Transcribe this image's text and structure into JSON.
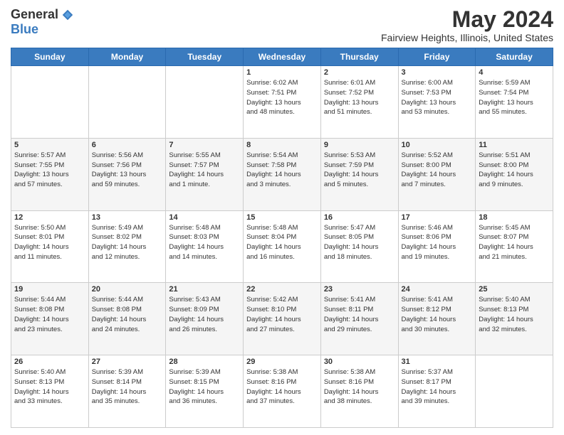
{
  "header": {
    "logo_general": "General",
    "logo_blue": "Blue",
    "month": "May 2024",
    "location": "Fairview Heights, Illinois, United States"
  },
  "days_of_week": [
    "Sunday",
    "Monday",
    "Tuesday",
    "Wednesday",
    "Thursday",
    "Friday",
    "Saturday"
  ],
  "weeks": [
    [
      {
        "day": "",
        "info": ""
      },
      {
        "day": "",
        "info": ""
      },
      {
        "day": "",
        "info": ""
      },
      {
        "day": "1",
        "info": "Sunrise: 6:02 AM\nSunset: 7:51 PM\nDaylight: 13 hours\nand 48 minutes."
      },
      {
        "day": "2",
        "info": "Sunrise: 6:01 AM\nSunset: 7:52 PM\nDaylight: 13 hours\nand 51 minutes."
      },
      {
        "day": "3",
        "info": "Sunrise: 6:00 AM\nSunset: 7:53 PM\nDaylight: 13 hours\nand 53 minutes."
      },
      {
        "day": "4",
        "info": "Sunrise: 5:59 AM\nSunset: 7:54 PM\nDaylight: 13 hours\nand 55 minutes."
      }
    ],
    [
      {
        "day": "5",
        "info": "Sunrise: 5:57 AM\nSunset: 7:55 PM\nDaylight: 13 hours\nand 57 minutes."
      },
      {
        "day": "6",
        "info": "Sunrise: 5:56 AM\nSunset: 7:56 PM\nDaylight: 13 hours\nand 59 minutes."
      },
      {
        "day": "7",
        "info": "Sunrise: 5:55 AM\nSunset: 7:57 PM\nDaylight: 14 hours\nand 1 minute."
      },
      {
        "day": "8",
        "info": "Sunrise: 5:54 AM\nSunset: 7:58 PM\nDaylight: 14 hours\nand 3 minutes."
      },
      {
        "day": "9",
        "info": "Sunrise: 5:53 AM\nSunset: 7:59 PM\nDaylight: 14 hours\nand 5 minutes."
      },
      {
        "day": "10",
        "info": "Sunrise: 5:52 AM\nSunset: 8:00 PM\nDaylight: 14 hours\nand 7 minutes."
      },
      {
        "day": "11",
        "info": "Sunrise: 5:51 AM\nSunset: 8:00 PM\nDaylight: 14 hours\nand 9 minutes."
      }
    ],
    [
      {
        "day": "12",
        "info": "Sunrise: 5:50 AM\nSunset: 8:01 PM\nDaylight: 14 hours\nand 11 minutes."
      },
      {
        "day": "13",
        "info": "Sunrise: 5:49 AM\nSunset: 8:02 PM\nDaylight: 14 hours\nand 12 minutes."
      },
      {
        "day": "14",
        "info": "Sunrise: 5:48 AM\nSunset: 8:03 PM\nDaylight: 14 hours\nand 14 minutes."
      },
      {
        "day": "15",
        "info": "Sunrise: 5:48 AM\nSunset: 8:04 PM\nDaylight: 14 hours\nand 16 minutes."
      },
      {
        "day": "16",
        "info": "Sunrise: 5:47 AM\nSunset: 8:05 PM\nDaylight: 14 hours\nand 18 minutes."
      },
      {
        "day": "17",
        "info": "Sunrise: 5:46 AM\nSunset: 8:06 PM\nDaylight: 14 hours\nand 19 minutes."
      },
      {
        "day": "18",
        "info": "Sunrise: 5:45 AM\nSunset: 8:07 PM\nDaylight: 14 hours\nand 21 minutes."
      }
    ],
    [
      {
        "day": "19",
        "info": "Sunrise: 5:44 AM\nSunset: 8:08 PM\nDaylight: 14 hours\nand 23 minutes."
      },
      {
        "day": "20",
        "info": "Sunrise: 5:44 AM\nSunset: 8:08 PM\nDaylight: 14 hours\nand 24 minutes."
      },
      {
        "day": "21",
        "info": "Sunrise: 5:43 AM\nSunset: 8:09 PM\nDaylight: 14 hours\nand 26 minutes."
      },
      {
        "day": "22",
        "info": "Sunrise: 5:42 AM\nSunset: 8:10 PM\nDaylight: 14 hours\nand 27 minutes."
      },
      {
        "day": "23",
        "info": "Sunrise: 5:41 AM\nSunset: 8:11 PM\nDaylight: 14 hours\nand 29 minutes."
      },
      {
        "day": "24",
        "info": "Sunrise: 5:41 AM\nSunset: 8:12 PM\nDaylight: 14 hours\nand 30 minutes."
      },
      {
        "day": "25",
        "info": "Sunrise: 5:40 AM\nSunset: 8:13 PM\nDaylight: 14 hours\nand 32 minutes."
      }
    ],
    [
      {
        "day": "26",
        "info": "Sunrise: 5:40 AM\nSunset: 8:13 PM\nDaylight: 14 hours\nand 33 minutes."
      },
      {
        "day": "27",
        "info": "Sunrise: 5:39 AM\nSunset: 8:14 PM\nDaylight: 14 hours\nand 35 minutes."
      },
      {
        "day": "28",
        "info": "Sunrise: 5:39 AM\nSunset: 8:15 PM\nDaylight: 14 hours\nand 36 minutes."
      },
      {
        "day": "29",
        "info": "Sunrise: 5:38 AM\nSunset: 8:16 PM\nDaylight: 14 hours\nand 37 minutes."
      },
      {
        "day": "30",
        "info": "Sunrise: 5:38 AM\nSunset: 8:16 PM\nDaylight: 14 hours\nand 38 minutes."
      },
      {
        "day": "31",
        "info": "Sunrise: 5:37 AM\nSunset: 8:17 PM\nDaylight: 14 hours\nand 39 minutes."
      },
      {
        "day": "",
        "info": ""
      }
    ]
  ]
}
